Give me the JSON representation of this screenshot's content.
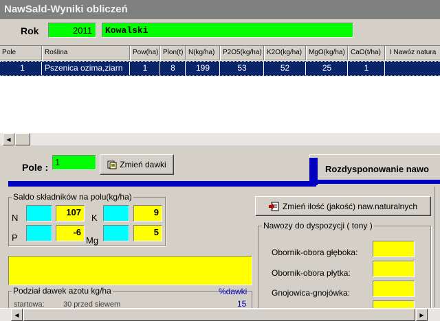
{
  "window": {
    "title": "NawSald-Wyniki obliczeń"
  },
  "header": {
    "rok_label": "Rok",
    "rok_value": "2011",
    "name_value": "Kowalski"
  },
  "grid": {
    "columns": [
      "Pole",
      "Roślina",
      "Pow(ha)",
      "Plon(t)",
      "N(kg/ha)",
      "P2O5(kg/ha)",
      "K2O(kg/ha)",
      "MgO(kg/ha)",
      "CaO(t/ha)",
      "I Nawóz natura"
    ],
    "row": [
      "1",
      "Pszenica ozima,ziarn",
      "1",
      "8",
      "199",
      "53",
      "52",
      "25",
      "1",
      ""
    ]
  },
  "pole": {
    "label": "Pole :",
    "value": "1",
    "change_button": "Zmień dawki"
  },
  "tab": {
    "label": "Rozdysponowanie nawo"
  },
  "saldo": {
    "title": "Saldo składników na polu(kg/ha)",
    "n_label": "N",
    "n_value": "107",
    "k_label": "K",
    "k_value": "9",
    "p_label": "P",
    "p_value": "-6",
    "mg_label": "Mg",
    "mg_value": "5"
  },
  "change_natural_button": "Zmień ilość (jakość) naw.naturalnych",
  "nawozy": {
    "title": "Nawozy do dyspozycji ( tony )",
    "items": [
      "Obornik-obora głęboka:",
      "Obornik-obora płytka:",
      "Gnojowica-gnojówka:"
    ]
  },
  "podzial": {
    "title": "Podział dawek azotu kg/ha",
    "percent_label": "%dawki",
    "row_label": "startowa:",
    "row_text": "30 przed siewem",
    "row_value": "15"
  }
}
